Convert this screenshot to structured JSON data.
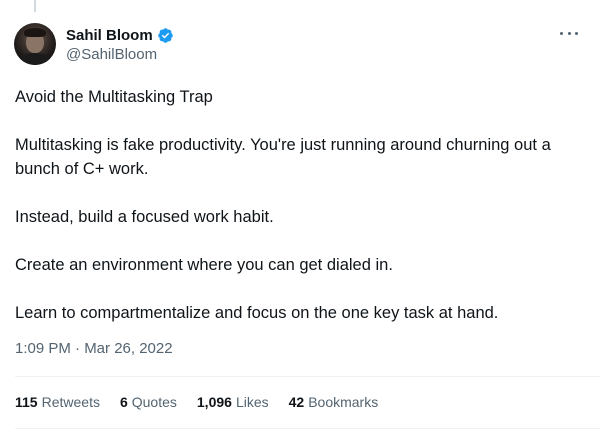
{
  "author": {
    "display_name": "Sahil Bloom",
    "handle": "@SahilBloom",
    "verified": true
  },
  "tweet": {
    "paragraphs": [
      "Avoid the Multitasking Trap",
      "Multitasking is fake productivity. You're just running around churning out a bunch of C+ work.",
      "Instead, build a focused work habit.",
      "Create an environment where you can get dialed in.",
      "Learn to compartmentalize and focus on the one key task at hand."
    ],
    "timestamp": "1:09 PM · Mar 26, 2022"
  },
  "stats": {
    "retweets": {
      "count": "115",
      "label": "Retweets"
    },
    "quotes": {
      "count": "6",
      "label": "Quotes"
    },
    "likes": {
      "count": "1,096",
      "label": "Likes"
    },
    "bookmarks": {
      "count": "42",
      "label": "Bookmarks"
    }
  },
  "colors": {
    "verified": "#1d9bf0",
    "text_primary": "#0f1419",
    "text_secondary": "#536471"
  }
}
